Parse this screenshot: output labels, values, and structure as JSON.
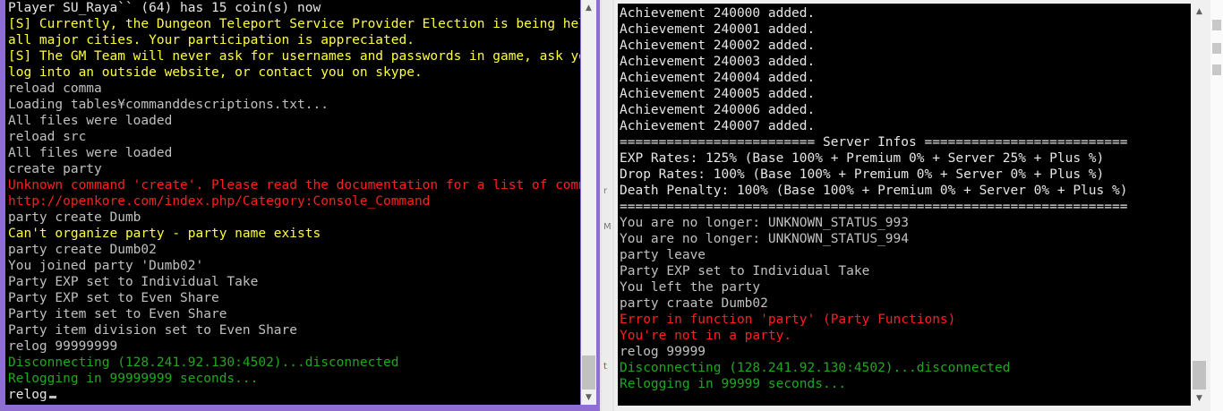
{
  "colors": {
    "default": "#c0c0c0",
    "yellow": "#ffff3a",
    "red": "#ff1f1f",
    "green": "#1fa81f",
    "white": "#e6e6e6"
  },
  "left_console": {
    "lines": [
      {
        "text": "Player SU_Raya`` (64) has 15 coin(s) now",
        "color": "white"
      },
      {
        "text": "[S] Currently, the Dungeon Teleport Service Provider Election is being held in",
        "color": "yellow"
      },
      {
        "text": "all major cities. Your participation is appreciated.",
        "color": "yellow"
      },
      {
        "text": "[S] The GM Team will never ask for usernames and passwords in game, ask you to",
        "color": "yellow"
      },
      {
        "text": "log into an outside website, or contact you on skype.",
        "color": "yellow"
      },
      {
        "text": "reload comma",
        "color": "default"
      },
      {
        "text": "Loading tables¥commanddescriptions.txt...",
        "color": "default"
      },
      {
        "text": "All files were loaded",
        "color": "default"
      },
      {
        "text": "reload src",
        "color": "default"
      },
      {
        "text": "All files were loaded",
        "color": "default"
      },
      {
        "text": "create party",
        "color": "default"
      },
      {
        "text": "Unknown command 'create'. Please read the documentation for a list of commands.",
        "color": "red"
      },
      {
        "text": "http://openkore.com/index.php/Category:Console_Command",
        "color": "red"
      },
      {
        "text": "party create Dumb",
        "color": "default"
      },
      {
        "text": "Can't organize party - party name exists",
        "color": "yellow"
      },
      {
        "text": "party create Dumb02",
        "color": "default"
      },
      {
        "text": "You joined party 'Dumb02'",
        "color": "default"
      },
      {
        "text": "Party EXP set to Individual Take",
        "color": "default"
      },
      {
        "text": "Party EXP set to Even Share",
        "color": "default"
      },
      {
        "text": "Party item set to Even Share",
        "color": "default"
      },
      {
        "text": "Party item division set to Even Share",
        "color": "default"
      },
      {
        "text": "relog 99999999",
        "color": "default"
      },
      {
        "text": "Disconnecting (128.241.92.130:4502)...disconnected",
        "color": "green"
      },
      {
        "text": "Relogging in 99999999 seconds...",
        "color": "green"
      }
    ],
    "input": "relog"
  },
  "right_console": {
    "lines": [
      {
        "text": "Achievement 240000 added.",
        "color": "white"
      },
      {
        "text": "Achievement 240001 added.",
        "color": "white"
      },
      {
        "text": "Achievement 240002 added.",
        "color": "white"
      },
      {
        "text": "Achievement 240003 added.",
        "color": "white"
      },
      {
        "text": "Achievement 240004 added.",
        "color": "white"
      },
      {
        "text": "Achievement 240005 added.",
        "color": "white"
      },
      {
        "text": "Achievement 240006 added.",
        "color": "white"
      },
      {
        "text": "Achievement 240007 added.",
        "color": "white"
      },
      {
        "text": "========================= Server Infos ==========================",
        "color": "white"
      },
      {
        "text": "EXP Rates: 125% (Base 100% + Premium 0% + Server 25% + Plus %)",
        "color": "white"
      },
      {
        "text": "Drop Rates: 100% (Base 100% + Premium 0% + Server 0% + Plus %)",
        "color": "white"
      },
      {
        "text": "Death Penalty: 100% (Base 100% + Premium 0% + Server 0% + Plus %)",
        "color": "white"
      },
      {
        "text": "=================================================================",
        "color": "white"
      },
      {
        "text": "You are no longer: UNKNOWN_STATUS_993",
        "color": "default"
      },
      {
        "text": "You are no longer: UNKNOWN_STATUS_994",
        "color": "default"
      },
      {
        "text": "party leave",
        "color": "default"
      },
      {
        "text": "Party EXP set to Individual Take",
        "color": "default"
      },
      {
        "text": "You left the party",
        "color": "default"
      },
      {
        "text": "party craate Dumb02",
        "color": "default"
      },
      {
        "text": "Error in function 'party' (Party Functions)",
        "color": "red"
      },
      {
        "text": "You're not in a party.",
        "color": "red"
      },
      {
        "text": "relog 99999",
        "color": "default"
      },
      {
        "text": "Disconnecting (128.241.92.130:4502)...disconnected",
        "color": "green"
      },
      {
        "text": "Relogging in 99999 seconds...",
        "color": "green"
      }
    ]
  },
  "icons": {
    "scroll_up": "up-arrow-icon",
    "scroll_down": "down-arrow-icon"
  },
  "glyphs": {
    "up": "▲",
    "down": "▼"
  },
  "strip_letters": [
    "r",
    "M",
    "t"
  ]
}
